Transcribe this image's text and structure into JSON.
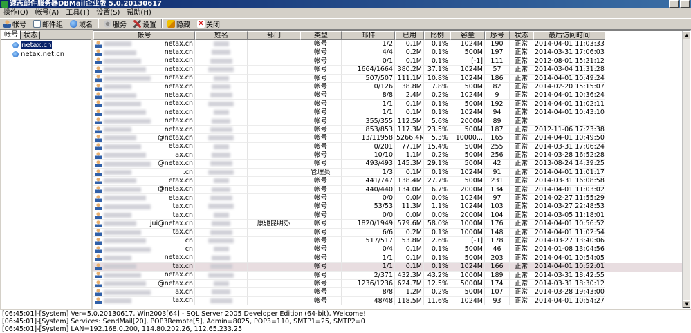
{
  "window": {
    "title": "速志邮件服务器DBMail企业版 5.0.20130617"
  },
  "menu": [
    {
      "label": "操作(O)"
    },
    {
      "label": "帐号(A)"
    },
    {
      "label": "工具(T)"
    },
    {
      "label": "设置(S)"
    },
    {
      "label": "帮助(H)"
    }
  ],
  "toolbar": {
    "account": "帐号",
    "group": "邮件组",
    "domain": "域名",
    "service": "服务",
    "settings": "设置",
    "hide": "隐藏",
    "close": "关闭"
  },
  "left_tabs": {
    "accounts": "帐号",
    "status": "状态"
  },
  "tree": [
    {
      "label": "netax.cn",
      "selected": true
    },
    {
      "label": "netax.net.cn",
      "selected": false
    }
  ],
  "columns": [
    "帐号",
    "姓名",
    "部门",
    "类型",
    "邮件",
    "已用",
    "比例",
    "容量",
    "序号",
    "状态",
    "最后访问时间"
  ],
  "rows": [
    {
      "acct": "netax.cn",
      "dept": "",
      "type": "帐号",
      "mail": "1/2",
      "used": "0.1M",
      "ratio": "0.1%",
      "cap": "1024M",
      "seq": "190",
      "status": "正常",
      "last": "2014-04-01 11:03:33"
    },
    {
      "acct": "netax.cn",
      "dept": "",
      "type": "帐号",
      "mail": "4/4",
      "used": "0.2M",
      "ratio": "0.1%",
      "cap": "500M",
      "seq": "197",
      "status": "正常",
      "last": "2014-03-31 17:06:03"
    },
    {
      "acct": "netax.cn",
      "dept": "",
      "type": "帐号",
      "mail": "0/1",
      "used": "0.1M",
      "ratio": "0.1%",
      "cap": "[-1]",
      "seq": "111",
      "status": "正常",
      "last": "2012-08-01 15:21:12"
    },
    {
      "acct": "netax.cn",
      "dept": "",
      "type": "帐号",
      "mail": "1664/1664",
      "used": "380.2M",
      "ratio": "37.1%",
      "cap": "1024M",
      "seq": "57",
      "status": "正常",
      "last": "2014-03-04 11:31:28"
    },
    {
      "acct": "netax.cn",
      "dept": "",
      "type": "帐号",
      "mail": "507/507",
      "used": "111.1M",
      "ratio": "10.8%",
      "cap": "1024M",
      "seq": "186",
      "status": "正常",
      "last": "2014-04-01 10:49:24"
    },
    {
      "acct": "netax.cn",
      "dept": "",
      "type": "帐号",
      "mail": "0/126",
      "used": "38.8M",
      "ratio": "7.8%",
      "cap": "500M",
      "seq": "82",
      "status": "正常",
      "last": "2014-02-20 15:15:07"
    },
    {
      "acct": "netax.cn",
      "dept": "",
      "type": "帐号",
      "mail": "8/8",
      "used": "2.4M",
      "ratio": "0.2%",
      "cap": "1024M",
      "seq": "9",
      "status": "正常",
      "last": "2014-04-01 10:36:24"
    },
    {
      "acct": "netax.cn",
      "dept": "",
      "type": "帐号",
      "mail": "1/1",
      "used": "0.1M",
      "ratio": "0.1%",
      "cap": "500M",
      "seq": "192",
      "status": "正常",
      "last": "2014-04-01 11:02:11"
    },
    {
      "acct": "netax.cn",
      "dept": "",
      "type": "帐号",
      "mail": "1/1",
      "used": "0.1M",
      "ratio": "0.1%",
      "cap": "1024M",
      "seq": "94",
      "status": "正常",
      "last": "2014-04-01 10:43:10"
    },
    {
      "acct": "netax.cn",
      "dept": "",
      "type": "帐号",
      "mail": "355/355",
      "used": "112.5M",
      "ratio": "5.6%",
      "cap": "2000M",
      "seq": "89",
      "status": "正常",
      "last": ""
    },
    {
      "acct": "netax.cn",
      "dept": "",
      "type": "帐号",
      "mail": "853/853",
      "used": "117.3M",
      "ratio": "23.5%",
      "cap": "500M",
      "seq": "187",
      "status": "正常",
      "last": "2012-11-06 17:23:38"
    },
    {
      "acct": "@netax.cn",
      "dept": "",
      "type": "帐号",
      "mail": "13/11958",
      "used": "5266.4M",
      "ratio": "5.3%",
      "cap": "10000...",
      "seq": "165",
      "status": "正常",
      "last": "2014-04-01 10:49:50"
    },
    {
      "acct": "etax.cn",
      "dept": "",
      "type": "帐号",
      "mail": "0/201",
      "used": "77.1M",
      "ratio": "15.4%",
      "cap": "500M",
      "seq": "255",
      "status": "正常",
      "last": "2014-03-31 17:06:24"
    },
    {
      "acct": "ax.cn",
      "dept": "",
      "type": "帐号",
      "mail": "10/10",
      "used": "1.1M",
      "ratio": "0.2%",
      "cap": "500M",
      "seq": "256",
      "status": "正常",
      "last": "2014-03-28 16:52:28"
    },
    {
      "acct": "@netax.cn",
      "dept": "",
      "type": "帐号",
      "mail": "493/493",
      "used": "145.3M",
      "ratio": "29.1%",
      "cap": "500M",
      "seq": "42",
      "status": "正常",
      "last": "2013-08-24 14:39:25"
    },
    {
      "acct": ".cn",
      "dept": "",
      "type": "管理员",
      "mail": "1/3",
      "used": "0.1M",
      "ratio": "0.1%",
      "cap": "1024M",
      "seq": "91",
      "status": "正常",
      "last": "2014-04-01 11:01:17"
    },
    {
      "acct": "etax.cn",
      "dept": "",
      "type": "帐号",
      "mail": "441/747",
      "used": "138.4M",
      "ratio": "27.7%",
      "cap": "500M",
      "seq": "231",
      "status": "正常",
      "last": "2014-03-31 16:08:58"
    },
    {
      "acct": "@netax.cn",
      "dept": "",
      "type": "帐号",
      "mail": "440/440",
      "used": "134.0M",
      "ratio": "6.7%",
      "cap": "2000M",
      "seq": "134",
      "status": "正常",
      "last": "2014-04-01 11:03:02"
    },
    {
      "acct": "etax.cn",
      "dept": "",
      "type": "帐号",
      "mail": "0/0",
      "used": "0.0M",
      "ratio": "0.0%",
      "cap": "1024M",
      "seq": "97",
      "status": "正常",
      "last": "2014-02-27 11:55:29"
    },
    {
      "acct": "tax.cn",
      "dept": "",
      "type": "帐号",
      "mail": "53/53",
      "used": "11.3M",
      "ratio": "1.1%",
      "cap": "1024M",
      "seq": "103",
      "status": "正常",
      "last": "2014-03-27 22:48:53"
    },
    {
      "acct": "tax.cn",
      "dept": "",
      "type": "帐号",
      "mail": "0/0",
      "used": "0.0M",
      "ratio": "0.0%",
      "cap": "2000M",
      "seq": "104",
      "status": "正常",
      "last": "2014-03-05 11:18:01"
    },
    {
      "acct": "jui@netax.cn",
      "dept": "康驰昆明办",
      "type": "帐号",
      "mail": "1820/1949",
      "used": "579.6M",
      "ratio": "58.0%",
      "cap": "1000M",
      "seq": "176",
      "status": "正常",
      "last": "2014-04-01 10:56:52"
    },
    {
      "acct": "tax.cn",
      "dept": "",
      "type": "帐号",
      "mail": "6/6",
      "used": "0.2M",
      "ratio": "0.1%",
      "cap": "1000M",
      "seq": "148",
      "status": "正常",
      "last": "2014-04-01 11:02:54"
    },
    {
      "acct": "cn",
      "dept": "",
      "type": "帐号",
      "mail": "517/517",
      "used": "53.8M",
      "ratio": "2.6%",
      "cap": "[-1]",
      "seq": "178",
      "status": "正常",
      "last": "2014-03-27 13:40:06"
    },
    {
      "acct": "cn",
      "dept": "",
      "type": "帐号",
      "mail": "0/4",
      "used": "0.1M",
      "ratio": "0.1%",
      "cap": "500M",
      "seq": "46",
      "status": "正常",
      "last": "2014-01-08 13:04:56"
    },
    {
      "acct": "netax.cn",
      "dept": "",
      "type": "帐号",
      "mail": "1/1",
      "used": "0.1M",
      "ratio": "0.1%",
      "cap": "500M",
      "seq": "203",
      "status": "正常",
      "last": "2014-04-01 10:54:05"
    },
    {
      "acct": "tax.cn",
      "dept": "",
      "type": "帐号",
      "mail": "1/1",
      "used": "0.1M",
      "ratio": "0.1%",
      "cap": "1024M",
      "seq": "166",
      "status": "正常",
      "last": "2014-04-01 10:52:01",
      "selected": true
    },
    {
      "acct": "netax.cn",
      "dept": "",
      "type": "帐号",
      "mail": "2/371",
      "used": "432.3M",
      "ratio": "43.2%",
      "cap": "1000M",
      "seq": "189",
      "status": "正常",
      "last": "2014-03-31 18:42:55"
    },
    {
      "acct": "@netax.cn",
      "dept": "",
      "type": "帐号",
      "mail": "1236/1236",
      "used": "624.7M",
      "ratio": "12.5%",
      "cap": "5000M",
      "seq": "174",
      "status": "正常",
      "last": "2014-03-31 18:30:12"
    },
    {
      "acct": "ax.cn",
      "dept": "",
      "type": "帐号",
      "mail": "8/8",
      "used": "1.2M",
      "ratio": "0.2%",
      "cap": "500M",
      "seq": "107",
      "status": "正常",
      "last": "2014-03-28 19:43:00"
    },
    {
      "acct": "tax.cn",
      "dept": "",
      "type": "帐号",
      "mail": "48/48",
      "used": "118.5M",
      "ratio": "11.6%",
      "cap": "1024M",
      "seq": "93",
      "status": "正常",
      "last": "2014-04-01 10:54:27"
    }
  ],
  "log": [
    "[06:45:01]-[System] Ver=5.0.20130617, Win2003[64] - SQL Server 2005 Developer Edition (64-bit), Welcome!",
    "[06:45:01]-[System] Services: SendMail[20], POP3Remote[5], Admin=8025, POP3=110, SMTP1=25, SMTP2=0",
    "[06:45:01]-[System] LAN=192.168.0.200, 114.80.202.26, 112.65.233.25"
  ]
}
